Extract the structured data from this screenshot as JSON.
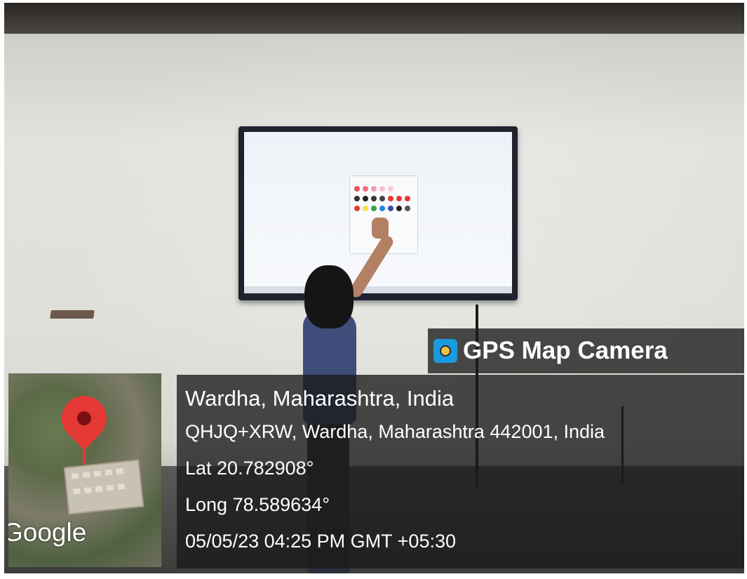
{
  "overlay": {
    "app_name": "GPS Map Camera",
    "location_title": "Wardha, Maharashtra, India",
    "address": "QHJQ+XRW, Wardha, Maharashtra 442001, India",
    "latitude": "Lat 20.782908°",
    "longitude": "Long 78.589634°",
    "timestamp": "05/05/23 04:25 PM GMT +05:30"
  },
  "map": {
    "attribution": "Google",
    "pin_color": "#e53935",
    "icon": "map-pin-icon"
  },
  "brand_icon": "gps-camera-icon"
}
